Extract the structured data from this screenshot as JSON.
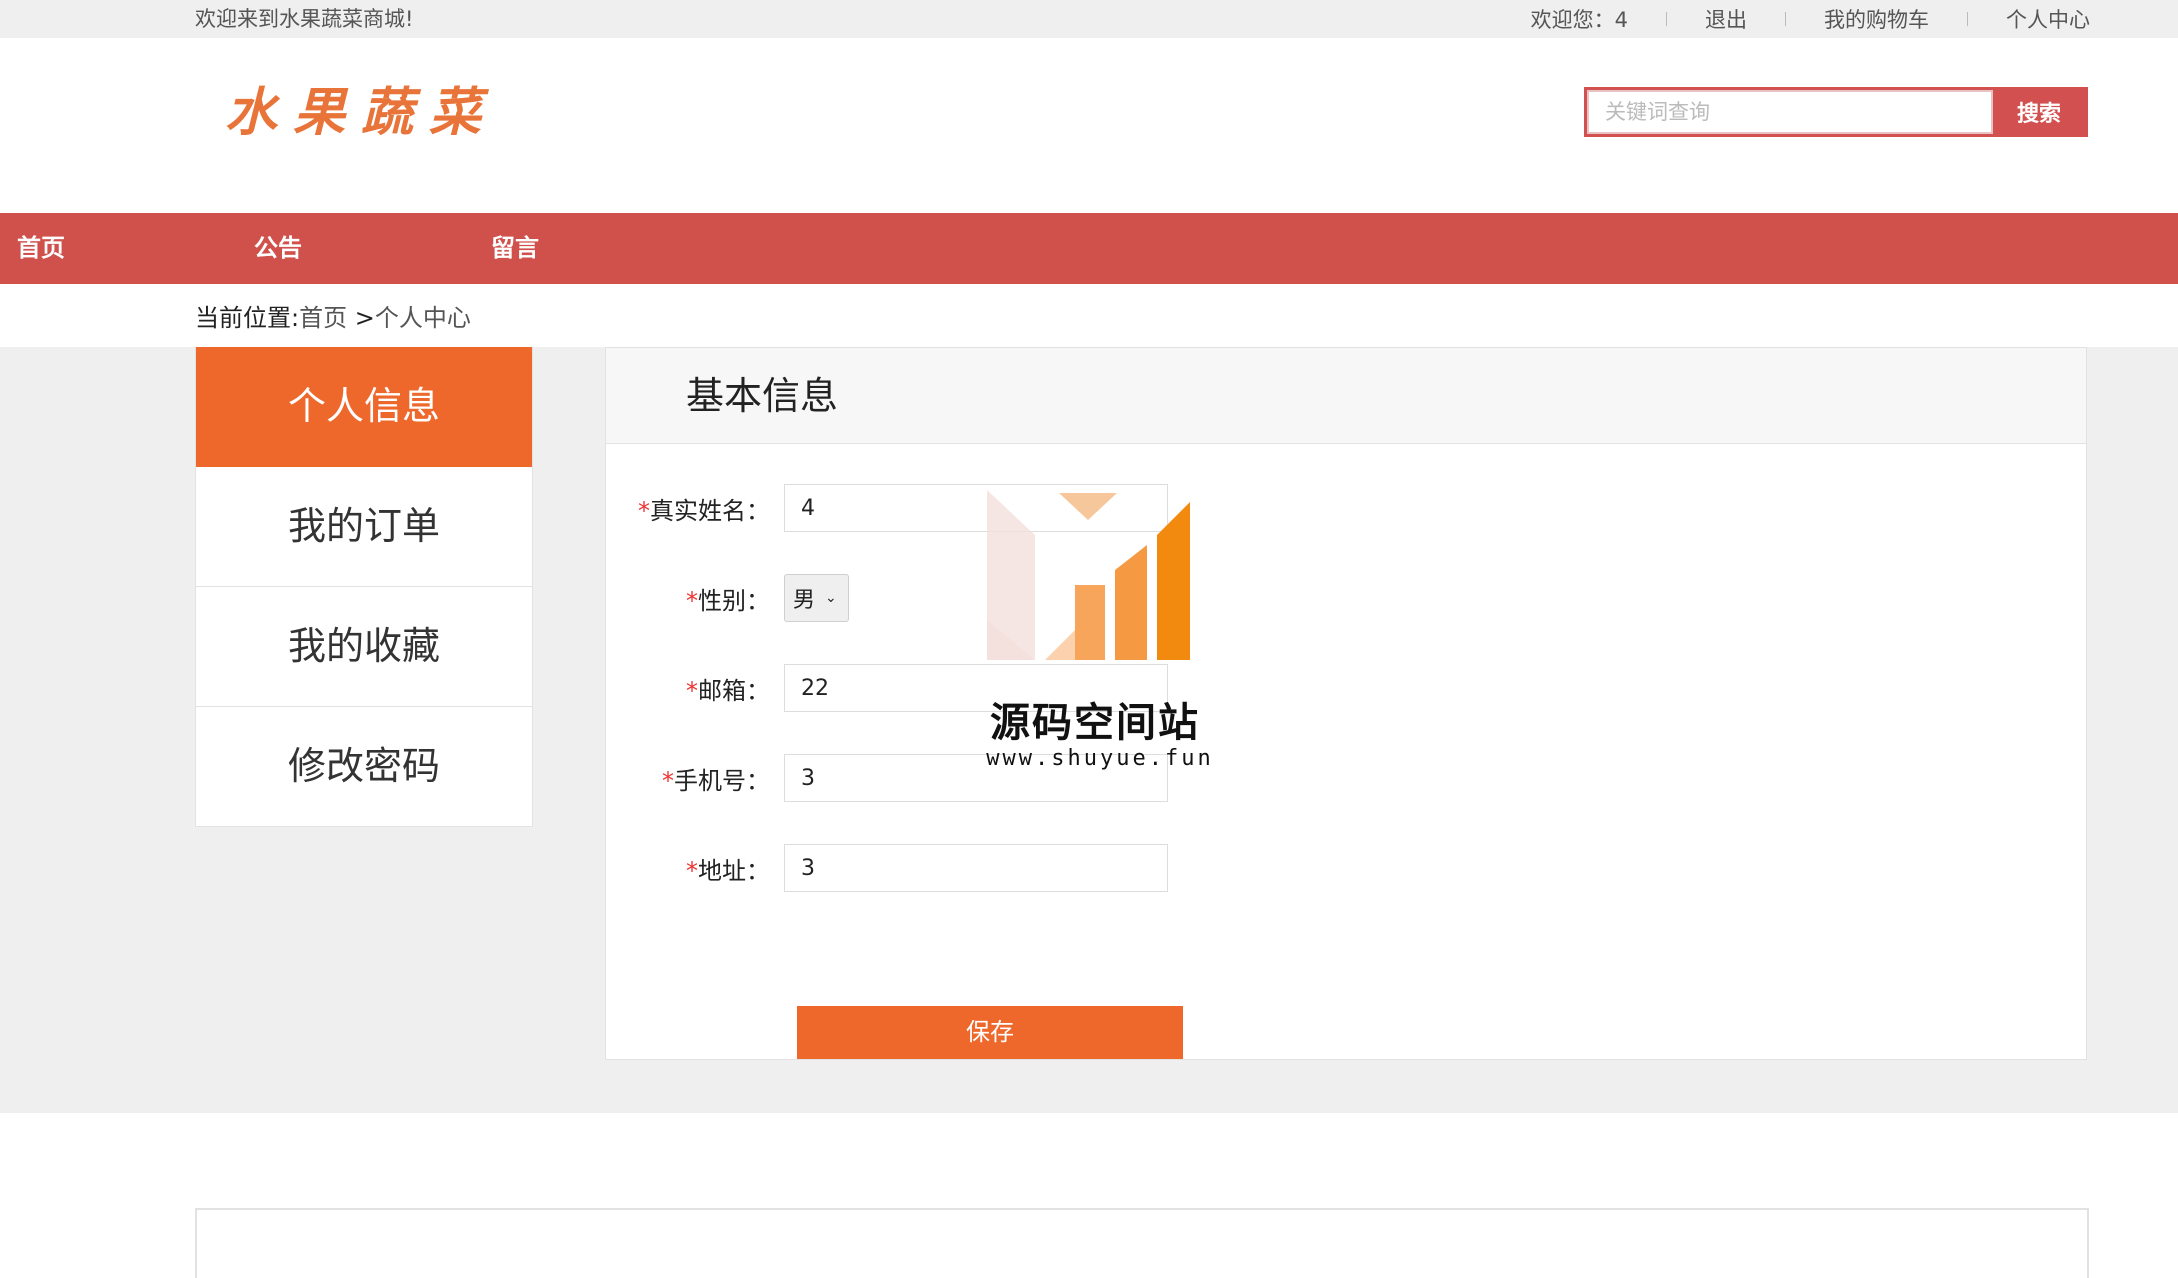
{
  "topbar": {
    "welcome": "欢迎来到水果蔬菜商城!",
    "user_greeting": "欢迎您：4",
    "logout": "退出",
    "cart": "我的购物车",
    "profile": "个人中心"
  },
  "header": {
    "logo_text": "水果蔬菜",
    "search_placeholder": "关键词查询",
    "search_button": "搜索"
  },
  "nav": {
    "items": [
      "首页",
      "公告",
      "留言"
    ]
  },
  "breadcrumb": {
    "prefix": "当前位置:",
    "home": "首页",
    "separator": " >",
    "current": "个人中心"
  },
  "sidebar": {
    "items": [
      {
        "label": "个人信息",
        "active": true
      },
      {
        "label": "我的订单",
        "active": false
      },
      {
        "label": "我的收藏",
        "active": false
      },
      {
        "label": "修改密码",
        "active": false
      }
    ]
  },
  "panel": {
    "title": "基本信息",
    "required_mark": "*",
    "fields": {
      "real_name": {
        "label": "真实姓名：",
        "value": "4"
      },
      "gender": {
        "label": "性别：",
        "value": "男"
      },
      "email": {
        "label": "邮箱：",
        "value": "22"
      },
      "phone": {
        "label": "手机号：",
        "value": "3"
      },
      "address": {
        "label": "地址：",
        "value": "3"
      }
    },
    "save_button": "保存"
  },
  "watermark": {
    "text": "源码空间站",
    "url": "www.shuyue.fun"
  },
  "colors": {
    "nav_red": "#d0504b",
    "accent_orange": "#ee672b"
  }
}
